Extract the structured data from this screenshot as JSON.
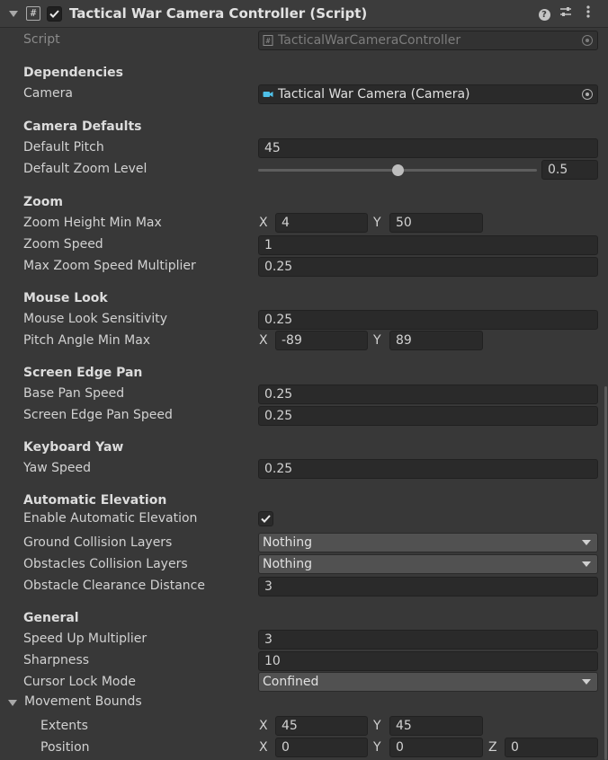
{
  "header": {
    "title": "Tactical War Camera Controller (Script)",
    "enabled": true
  },
  "script": {
    "label": "Script",
    "value": "TacticalWarCameraController"
  },
  "sections": {
    "dependencies": "Dependencies",
    "camera_defaults": "Camera Defaults",
    "zoom": "Zoom",
    "mouse_look": "Mouse Look",
    "screen_edge_pan": "Screen Edge Pan",
    "keyboard_yaw": "Keyboard Yaw",
    "automatic_elevation": "Automatic Elevation",
    "general": "General",
    "movement_bounds": "Movement Bounds"
  },
  "fields": {
    "camera": {
      "label": "Camera",
      "value": "Tactical War Camera (Camera)"
    },
    "default_pitch": {
      "label": "Default Pitch",
      "value": "45"
    },
    "default_zoom_level": {
      "label": "Default Zoom Level",
      "value": "0.5",
      "slider_fraction": 0.5
    },
    "zoom_height_min_max": {
      "label": "Zoom Height Min Max",
      "x": "4",
      "y": "50"
    },
    "zoom_speed": {
      "label": "Zoom Speed",
      "value": "1"
    },
    "max_zoom_speed_multiplier": {
      "label": "Max Zoom Speed Multiplier",
      "value": "0.25"
    },
    "mouse_look_sensitivity": {
      "label": "Mouse Look Sensitivity",
      "value": "0.25"
    },
    "pitch_angle_min_max": {
      "label": "Pitch Angle Min Max",
      "x": "-89",
      "y": "89"
    },
    "base_pan_speed": {
      "label": "Base Pan Speed",
      "value": "0.25"
    },
    "screen_edge_pan_speed": {
      "label": "Screen Edge Pan Speed",
      "value": "0.25"
    },
    "yaw_speed": {
      "label": "Yaw Speed",
      "value": "0.25"
    },
    "enable_automatic_elevation": {
      "label": "Enable Automatic Elevation",
      "checked": true
    },
    "ground_collision_layers": {
      "label": "Ground Collision Layers",
      "value": "Nothing"
    },
    "obstacles_collision_layers": {
      "label": "Obstacles Collision Layers",
      "value": "Nothing"
    },
    "obstacle_clearance_distance": {
      "label": "Obstacle Clearance Distance",
      "value": "3"
    },
    "speed_up_multiplier": {
      "label": "Speed Up Multiplier",
      "value": "3"
    },
    "sharpness": {
      "label": "Sharpness",
      "value": "10"
    },
    "cursor_lock_mode": {
      "label": "Cursor Lock Mode",
      "value": "Confined"
    },
    "extents": {
      "label": "Extents",
      "x": "45",
      "y": "45"
    },
    "position": {
      "label": "Position",
      "x": "0",
      "y": "0",
      "z": "0"
    }
  },
  "axes": {
    "x": "X",
    "y": "Y",
    "z": "Z"
  },
  "icons": {
    "script": "script-hash-icon",
    "help": "help-icon",
    "presets": "presets-sliders-icon",
    "menu": "kebab-menu-icon",
    "camera": "camera-icon",
    "check": "checkmark-icon"
  },
  "colors": {
    "background": "#383838",
    "field": "#2a2a2a",
    "dropdown": "#515151",
    "camera_icon": "#4fc1e9"
  }
}
